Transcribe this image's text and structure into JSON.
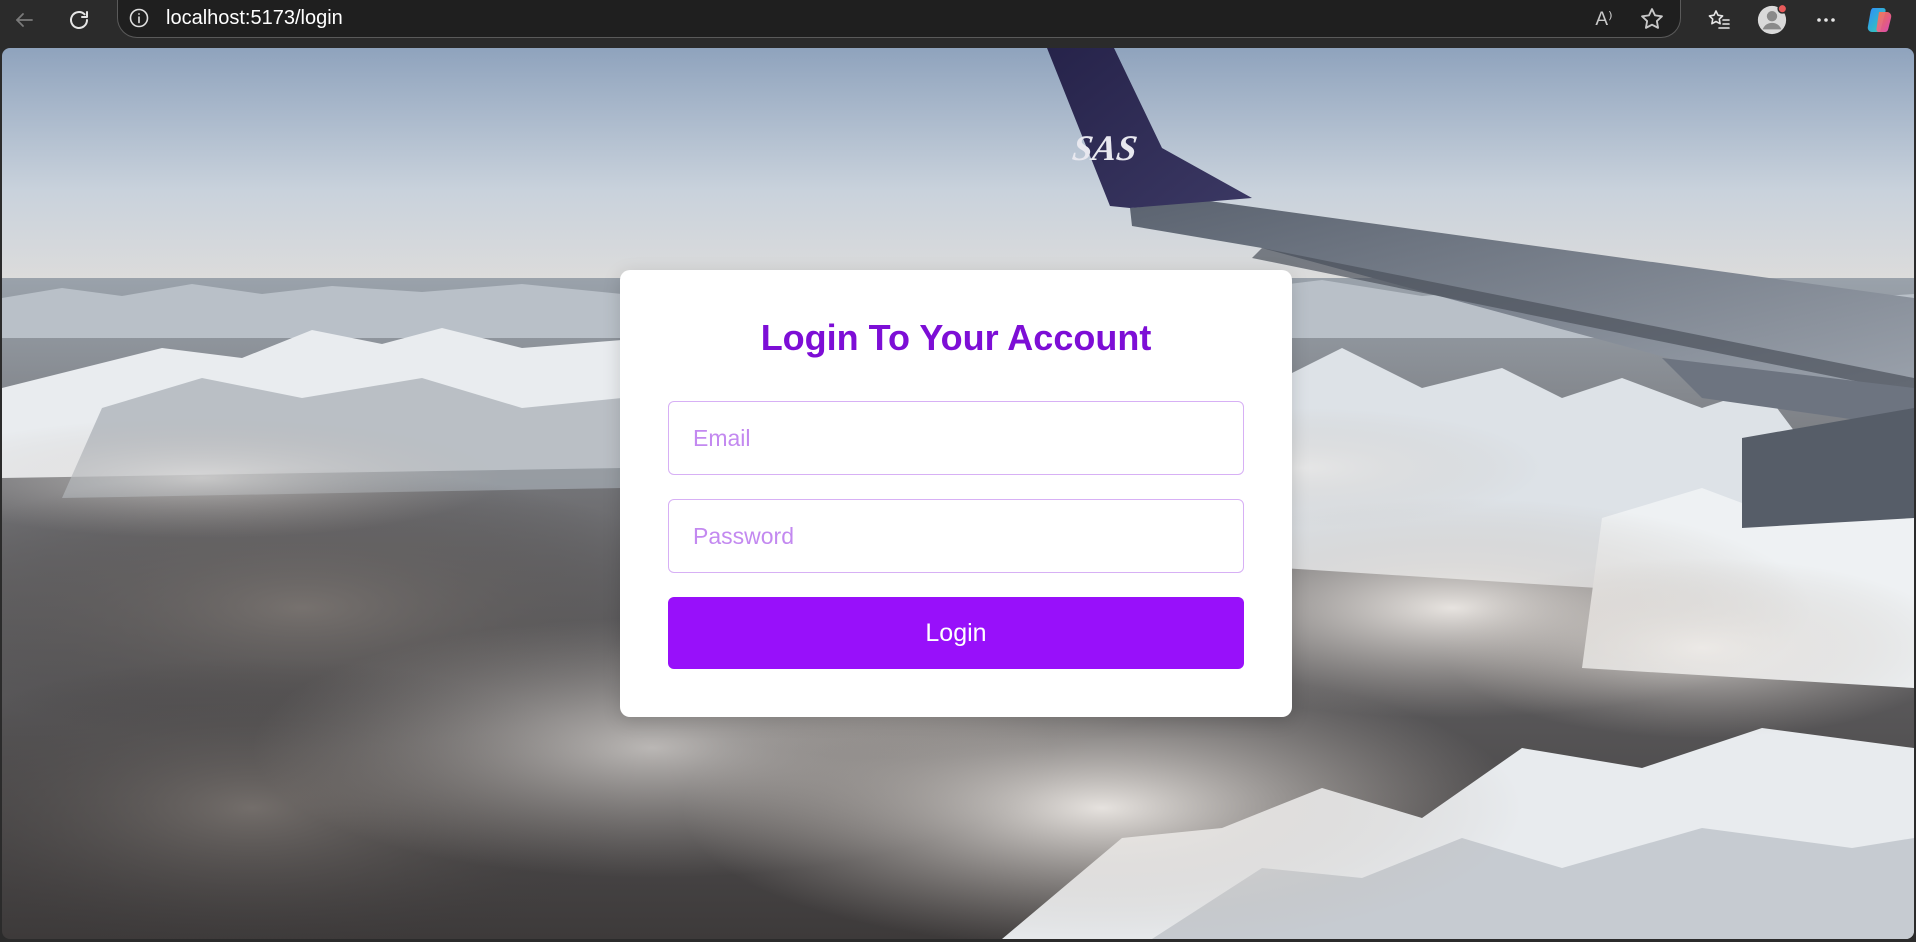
{
  "browser": {
    "url": "localhost:5173/login",
    "icons": {
      "back": "arrow-left-icon",
      "reload": "reload-icon",
      "info": "info-icon",
      "read_aloud": "read-aloud-icon",
      "favorite": "star-icon",
      "favorites": "favorites-icon",
      "profile": "profile-icon",
      "more": "more-icon",
      "copilot": "copilot-icon"
    },
    "read_aloud_glyph": "A⁾"
  },
  "login": {
    "title": "Login To Your Account",
    "email_placeholder": "Email",
    "email_value": "",
    "password_placeholder": "Password",
    "password_value": "",
    "button_label": "Login"
  },
  "background": {
    "airline_logo_text": "SAS",
    "scene": "airplane wing over snowy mountains and clouds"
  },
  "colors": {
    "accent": "#9810fa",
    "title": "#7d0ed6",
    "placeholder": "#c389f0",
    "field_border": "#d7b0f5"
  }
}
